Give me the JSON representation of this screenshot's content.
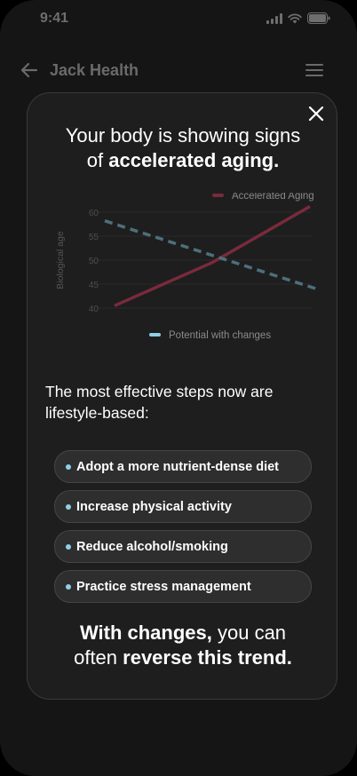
{
  "status": {
    "time": "9:41"
  },
  "header": {
    "title": "Jack Health",
    "back_icon": "arrow-left-icon",
    "menu_icon": "hamburger-menu-icon"
  },
  "modal": {
    "close_icon": "close-icon",
    "headline_line1": "Your body is showing signs",
    "headline_prefix": "of ",
    "headline_bold": "accelerated aging.",
    "steps_intro": "The most effective steps now are lifestyle-based:",
    "steps": [
      "Adopt a more nutrient-dense diet",
      "Increase physical activity",
      "Reduce alcohol/smoking",
      "Practice stress management"
    ],
    "footer_bold1": "With changes,",
    "footer_text1": " you can",
    "footer_text2": "often ",
    "footer_bold2": "reverse this trend."
  },
  "colors": {
    "accelerated": "#7a2a3c",
    "potential": "#4e6f7b",
    "step_dot": "#8ed0e6"
  },
  "chart_data": {
    "type": "line",
    "ylabel": "Biological age",
    "yticks": [
      60,
      55,
      50,
      45,
      40
    ],
    "ylim": [
      40,
      60
    ],
    "grid": true,
    "legend": [
      "top-right",
      "bottom-center"
    ],
    "series": [
      {
        "name": "Accelerated Aging",
        "style": "solid",
        "color": "#7a2a3c",
        "points": [
          [
            0,
            40.5
          ],
          [
            0.5,
            49.5
          ],
          [
            1.0,
            61.2
          ]
        ]
      },
      {
        "name": "Potential with changes",
        "style": "dashed",
        "color": "#4e6f7b",
        "points": [
          [
            -0.05,
            58.2
          ],
          [
            1.05,
            43.8
          ]
        ]
      }
    ]
  }
}
